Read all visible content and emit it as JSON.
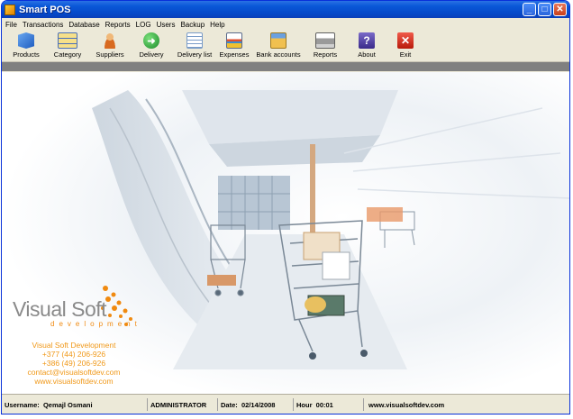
{
  "window": {
    "title": "Smart POS",
    "controls": [
      "minimize-icon",
      "maximize-icon",
      "close-icon"
    ]
  },
  "menu": [
    "File",
    "Transactions",
    "Database",
    "Reports",
    "LOG",
    "Users",
    "Backup",
    "Help"
  ],
  "toolbar": [
    {
      "label": "Products",
      "icon": "products-icon",
      "color": "#3a7bd5"
    },
    {
      "label": "Category",
      "icon": "category-icon",
      "color": "#f2d05a"
    },
    {
      "label": "Suppliers",
      "icon": "suppliers-icon",
      "color": "#e8a040"
    },
    {
      "label": "Delivery",
      "icon": "delivery-icon",
      "color": "#2ea83a"
    },
    {
      "label": "Delivery list",
      "icon": "delivery-list-icon",
      "color": "#7a9cc8"
    },
    {
      "label": "Expenses",
      "icon": "expenses-icon",
      "color": "#d0d8e8"
    },
    {
      "label": "Bank accounts",
      "icon": "bank-accounts-icon",
      "color": "#e8b84a"
    },
    {
      "label": "Reports",
      "icon": "reports-icon",
      "color": "#b8b8b8"
    },
    {
      "label": "About",
      "icon": "about-icon",
      "color": "#5a4a9a"
    },
    {
      "label": "Exit",
      "icon": "exit-icon",
      "color": "#d82a1a"
    }
  ],
  "brand": {
    "name": "Visual Soft",
    "sub": "development",
    "contact": [
      "Visual Soft Development",
      "+377 (44) 206-926",
      "+386 (49) 206-926",
      "contact@visualsoftdev.com",
      "www.visualsoftdev.com"
    ]
  },
  "status": {
    "username_label": "Username:",
    "username": "Qemajl Osmani",
    "role": "ADMINISTRATOR",
    "date_label": "Date:",
    "date": "02/14/2008",
    "hour_label": "Hour",
    "hour": "00:01",
    "website": "www.visualsoftdev.com"
  },
  "colors": {
    "titlebar": "#0548c8",
    "accent": "#f09818",
    "chrome": "#ece9d8"
  }
}
